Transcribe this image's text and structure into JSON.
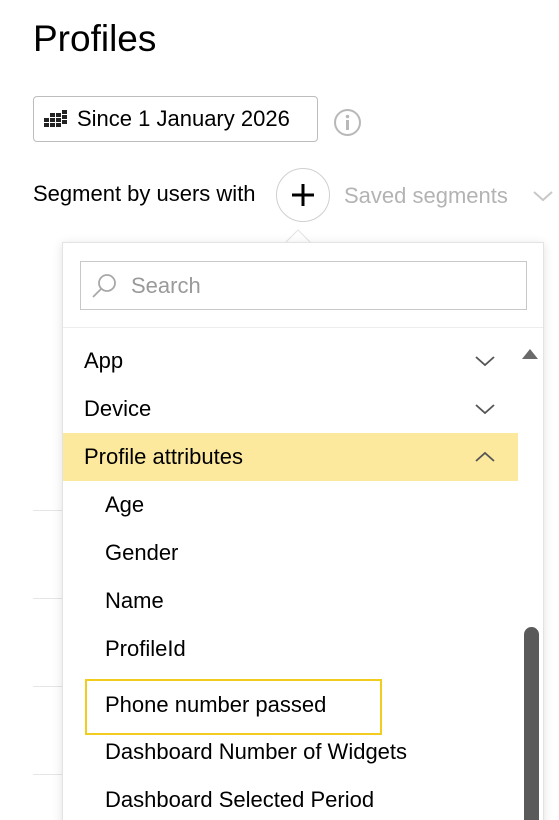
{
  "page": {
    "title": "Profiles"
  },
  "date_filter": {
    "label": "Since 1 January 2026",
    "icon": "calendar-grid-icon"
  },
  "info": {
    "icon": "info-icon"
  },
  "segment": {
    "label": "Segment by users with",
    "add_icon": "plus-icon",
    "saved_label": "Saved segments"
  },
  "dropdown": {
    "search_placeholder": "Search",
    "search_value": "",
    "groups": [
      {
        "label": "App",
        "expanded": false
      },
      {
        "label": "Device",
        "expanded": false
      },
      {
        "label": "Profile attributes",
        "expanded": true
      }
    ],
    "items": [
      {
        "label": "Age"
      },
      {
        "label": "Gender"
      },
      {
        "label": "Name"
      },
      {
        "label": "ProfileId"
      },
      {
        "label": "Phone number passed",
        "highlighted": true
      },
      {
        "label": "Dashboard Number of Widgets"
      },
      {
        "label": "Dashboard Selected Period"
      }
    ]
  },
  "colors": {
    "active_row": "#fde99d",
    "highlight_border": "#f3cc20",
    "muted_text": "#b3b3b3",
    "scroll_thumb": "#5a5a5a"
  }
}
